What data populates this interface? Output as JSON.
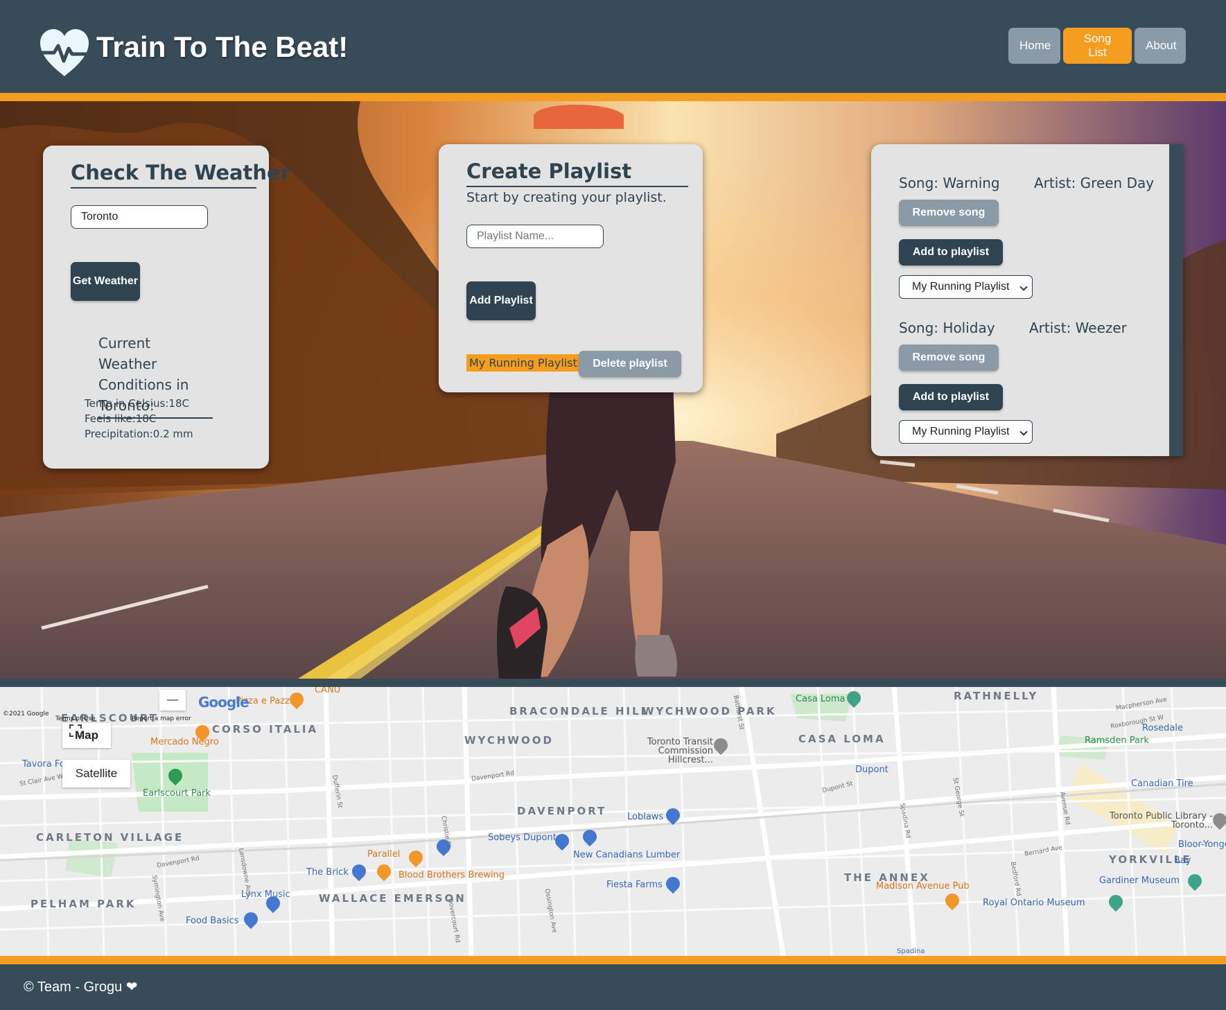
{
  "header": {
    "brand": "Train To The Beat!",
    "nav": [
      {
        "label": "Home",
        "active": false
      },
      {
        "label": "Song List",
        "active": true
      },
      {
        "label": "About",
        "active": false
      }
    ]
  },
  "colors": {
    "header_bg": "#374b59",
    "accent": "#f49d1f",
    "panel_bg": "#e3e3e3",
    "dark_button": "#2f4350",
    "grey_button": "#8a9aa7"
  },
  "weather": {
    "title": "Check The Weather",
    "city_value": "Toronto",
    "get_button": "Get Weather",
    "conditions_title": "Current Weather Conditions in Toronto:",
    "temp": "Temp in Celsius:18C",
    "feels": "Feels like:18C",
    "precip": "Precipitation:0.2 mm"
  },
  "playlist": {
    "title": "Create Playlist",
    "subtitle": "Start by creating your playlist.",
    "name_placeholder": "Playlist Name...",
    "add_button": "Add Playlist",
    "playlist_name": "My Running Playlist",
    "delete_button": "Delete playlist"
  },
  "songs": [
    {
      "song": "Song: Warning",
      "artist": "Artist: Green Day",
      "remove": "Remove song",
      "add": "Add to playlist",
      "selected_playlist": "My Running Playlist"
    },
    {
      "song": "Song: Holiday",
      "artist": "Artist: Weezer",
      "remove": "Remove song",
      "add": "Add to playlist",
      "selected_playlist": "My Running Playlist"
    }
  ],
  "map": {
    "copyright": "©2021 Google",
    "terms": "Terms of Use",
    "report": "Report a map error",
    "google": "Google",
    "type_map": "Map",
    "type_satellite": "Satellite",
    "zoom_out": "—",
    "areas": [
      "EARLSCOURT",
      "CORSO ITALIA",
      "BRACONDALE HILL",
      "WYCHWOOD PARK",
      "WYCHWOOD",
      "CASA LOMA",
      "RATHNELLY",
      "DAVENPORT",
      "CARLETON VILLAGE",
      "PELHAM PARK",
      "WALLACE EMERSON",
      "THE ANNEX",
      "YORKVILLE"
    ],
    "pois": [
      "Mercado Negro",
      "Tavora Foods",
      "Earlscourt Park",
      "Casa Loma",
      "Toronto Transit Commission Hillcrest...",
      "Rosedale",
      "Ramsden Park",
      "Canadian Tire",
      "Toronto Public Library - Toronto...",
      "Bloor-Yonge",
      "Bay",
      "Gardiner Museum",
      "Royal Ontario Museum",
      "Madison Avenue Pub",
      "Loblaws",
      "Sobeys Dupont",
      "New Canadians Lumber",
      "Fiesta Farms",
      "Parallel",
      "The Brick",
      "Blood Brothers Brewing",
      "Lynx Music",
      "Food Basics",
      "Dupont",
      "Spadina",
      "CANU",
      "Pizza e Pazzi"
    ],
    "streets": [
      "Davenport Rd",
      "Dupont St",
      "St Clair Ave W",
      "Dufferin St",
      "Lansdowne Ave",
      "Ossington Ave",
      "Bathurst St",
      "Spadina Rd",
      "Avenue Rd",
      "Bedford Rd",
      "St George St",
      "Christie St",
      "Symington Ave",
      "Davenport Rd",
      "Dovercourt Rd",
      "Bernard Ave",
      "Macpherson Ave",
      "Roxborough St W"
    ]
  },
  "footer": {
    "text": "© Team - Grogu ❤"
  }
}
